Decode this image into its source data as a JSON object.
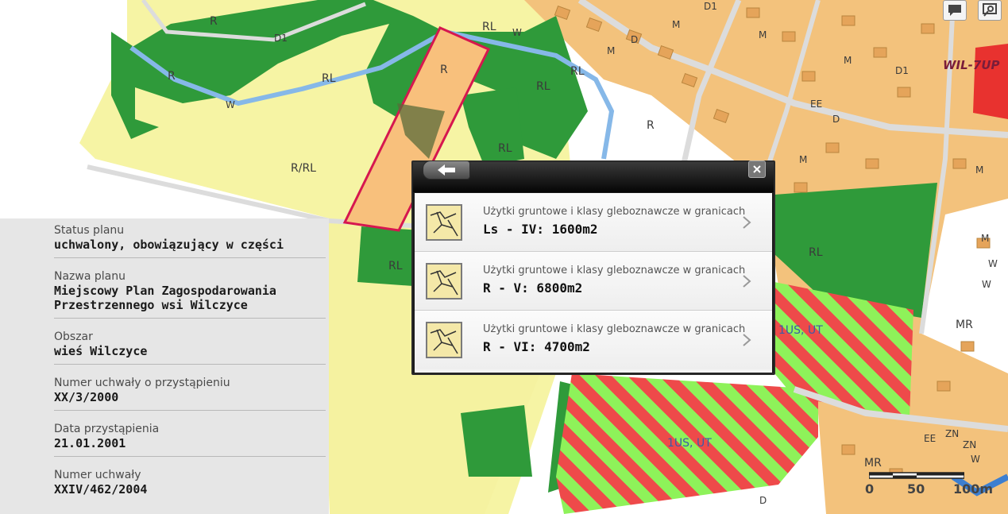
{
  "map": {
    "labels": {
      "r1": "R",
      "r2": "R",
      "r3": "R",
      "r4": "R",
      "d1_a": "D1",
      "d1_b": "D1",
      "d1_c": "D1",
      "rl1": "RL",
      "rl2": "RL",
      "rl3": "RL",
      "rl4": "RL",
      "rl5": "RL",
      "rl6": "RL",
      "rl7": "RL",
      "w1": "W",
      "w2": "W",
      "w3": "W",
      "w4": "W",
      "w5": "W",
      "rrl": "R/RL",
      "m1": "M",
      "m2": "M",
      "m3": "M",
      "m4": "M",
      "m5": "M",
      "m6": "M",
      "m7": "M",
      "d1": "D",
      "d2": "D",
      "d3": "D",
      "ee1": "EE",
      "ee2": "EE",
      "mr1": "MR",
      "mr2": "MR",
      "zn1": "ZN",
      "zn2": "ZN",
      "wil": "WIL-7UP",
      "us1": "1US, UT",
      "us2": "1US, UT"
    },
    "colors": {
      "yellow": "#f6f4a4",
      "green": "#2f9a3a",
      "orange": "#f3c27c",
      "water": "#86b8e8",
      "red_stripe": "#ee4a4a",
      "lime_stripe": "#8ef25a",
      "highlight": "#d6174f",
      "red_zone": "#e8322f"
    }
  },
  "tools": {
    "comment_icon": "comment-icon",
    "search_icon": "search-icon"
  },
  "panel": {
    "rows": [
      {
        "label": "Status planu",
        "value": "uchwalony, obowiązujący w części"
      },
      {
        "label": "Nazwa planu",
        "value": "Miejscowy Plan Zagospodarowania\nPrzestrzennego wsi Wilczyce"
      },
      {
        "label": "Obszar",
        "value": "wieś Wilczyce"
      },
      {
        "label": "Numer uchwały o przystąpieniu",
        "value": "XX/3/2000"
      },
      {
        "label": "Data przystąpienia",
        "value": "21.01.2001"
      },
      {
        "label": "Numer uchwały",
        "value": "XXIV/462/2004"
      }
    ]
  },
  "popup": {
    "back_icon": "arrow-left-icon",
    "close_icon": "close-icon",
    "items": [
      {
        "title": "Użytki gruntowe i klasy gleboznawcze w granicach",
        "value": "Ls - IV: 1600m2"
      },
      {
        "title": "Użytki gruntowe i klasy gleboznawcze w granicach",
        "value": "R - V: 6800m2"
      },
      {
        "title": "Użytki gruntowe i klasy gleboznawcze w granicach",
        "value": "R - VI: 4700m2"
      }
    ]
  },
  "scale": {
    "zero": "0",
    "mid": "50",
    "end": "100m"
  }
}
